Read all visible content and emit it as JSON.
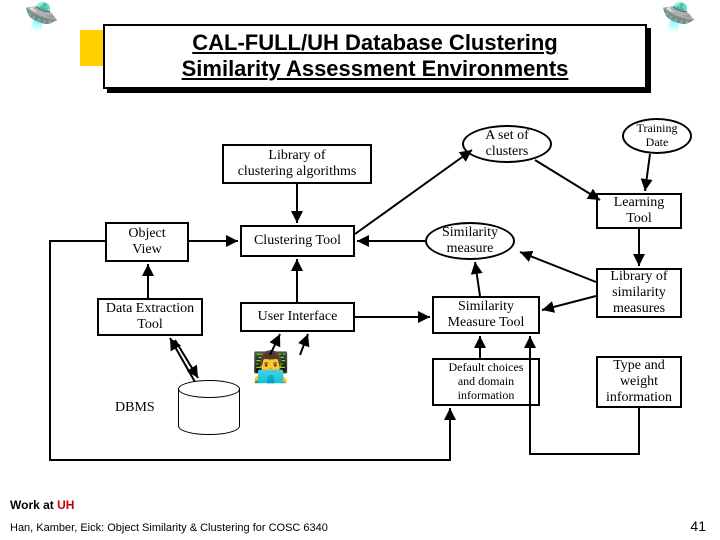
{
  "title": {
    "line1": "CAL-FULL/UH Database Clustering",
    "line2": "Similarity Assessment Environments"
  },
  "boxes": {
    "library_alg": "Library of\nclustering algorithms",
    "set_clusters": "A set of\nclusters",
    "training_date": "Training\nDate",
    "learning_tool": "Learning\nTool",
    "object_view": "Object\nView",
    "clustering_tool": "Clustering Tool",
    "similarity_measure": "Similarity\nmeasure",
    "library_sim": "Library of\nsimilarity\nmeasures",
    "data_extraction": "Data Extraction\nTool",
    "user_interface": "User Interface",
    "sim_measure_tool": "Similarity\nMeasure Tool",
    "default_choices": "Default choices\nand domain\ninformation",
    "type_weight": "Type and\nweight\ninformation",
    "dbms": "DBMS"
  },
  "footer": {
    "work_at": "Work at ",
    "uh": "UH",
    "credit": "Han, Kamber, Eick: Object Similarity & Clustering for COSC 6340",
    "page": "41"
  },
  "icons": {
    "ship": "🛸",
    "user": "👨‍💻"
  }
}
